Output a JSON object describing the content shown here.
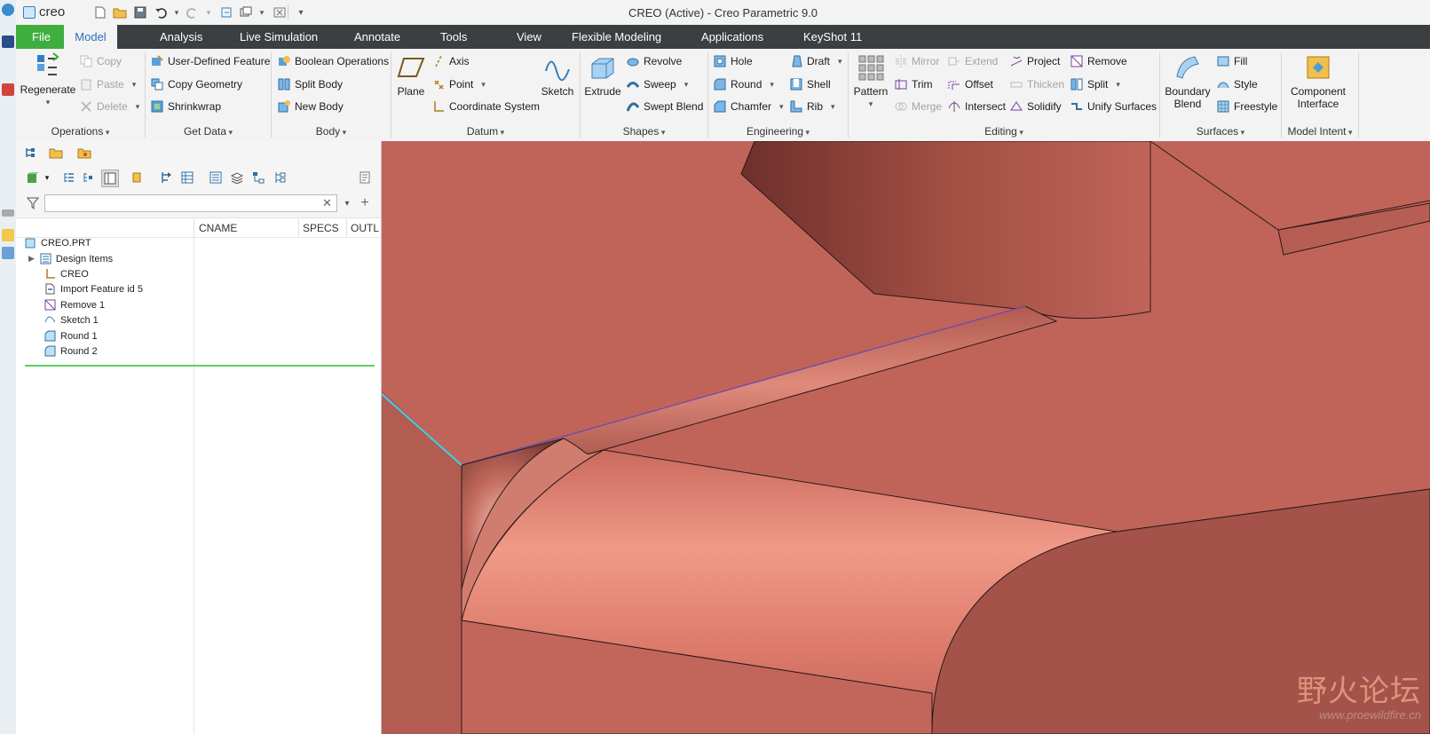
{
  "titlebar": {
    "logo_text": "creo",
    "window_title": "CREO (Active) - Creo Parametric 9.0"
  },
  "ribbon_tabs": [
    "File",
    "Model",
    "Analysis",
    "Live Simulation",
    "Annotate",
    "Tools",
    "View",
    "Flexible Modeling",
    "Applications",
    "KeyShot 11"
  ],
  "ribbon": {
    "operations": {
      "label": "Operations",
      "regenerate": "Regenerate",
      "copy": "Copy",
      "paste": "Paste",
      "delete": "Delete"
    },
    "get_data": {
      "label": "Get Data",
      "udf": "User-Defined Feature",
      "copy_geometry": "Copy Geometry",
      "shrinkwrap": "Shrinkwrap"
    },
    "body": {
      "label": "Body",
      "boolean": "Boolean Operations",
      "split_body": "Split Body",
      "new_body": "New Body"
    },
    "datum": {
      "label": "Datum",
      "plane": "Plane",
      "axis": "Axis",
      "point": "Point",
      "csys": "Coordinate System",
      "sketch": "Sketch"
    },
    "shapes": {
      "label": "Shapes",
      "extrude": "Extrude",
      "revolve": "Revolve",
      "sweep": "Sweep",
      "swept_blend": "Swept Blend"
    },
    "engineering": {
      "label": "Engineering",
      "hole": "Hole",
      "round": "Round",
      "chamfer": "Chamfer",
      "draft": "Draft",
      "shell": "Shell",
      "rib": "Rib"
    },
    "editing": {
      "label": "Editing",
      "pattern": "Pattern",
      "mirror": "Mirror",
      "trim": "Trim",
      "merge": "Merge",
      "extend": "Extend",
      "offset": "Offset",
      "intersect": "Intersect",
      "project": "Project",
      "thicken": "Thicken",
      "solidify": "Solidify",
      "remove": "Remove",
      "split": "Split",
      "unify": "Unify Surfaces"
    },
    "surfaces": {
      "label": "Surfaces",
      "boundary_blend_1": "Boundary",
      "boundary_blend_2": "Blend",
      "fill": "Fill",
      "style": "Style",
      "freestyle": "Freestyle"
    },
    "model_intent": {
      "label": "Model Intent",
      "component_1": "Component",
      "component_2": "Interface"
    }
  },
  "model_tree": {
    "columns": [
      "CNAME",
      "SPECS",
      "OUTL"
    ],
    "search_value": "",
    "items": [
      {
        "label": "CREO.PRT",
        "icon": "part-icon"
      },
      {
        "label": "Design Items",
        "icon": "design-items-icon"
      },
      {
        "label": "CREO",
        "icon": "csys-icon"
      },
      {
        "label": "Import Feature id 5",
        "icon": "import-feature-icon"
      },
      {
        "label": "Remove 1",
        "icon": "remove-icon"
      },
      {
        "label": "Sketch 1",
        "icon": "sketch-icon"
      },
      {
        "label": "Round 1",
        "icon": "round-icon"
      },
      {
        "label": "Round 2",
        "icon": "round-icon"
      }
    ]
  },
  "watermark": {
    "cn": "野火论坛",
    "url": "www.proewildfire.cn"
  },
  "colors": {
    "model": "#c0645a",
    "ribbon_bar": "#3b3f42",
    "file_tab": "#3fae3f",
    "highlight_edge": "#35d4e8",
    "insert_line": "#5fd05f"
  }
}
